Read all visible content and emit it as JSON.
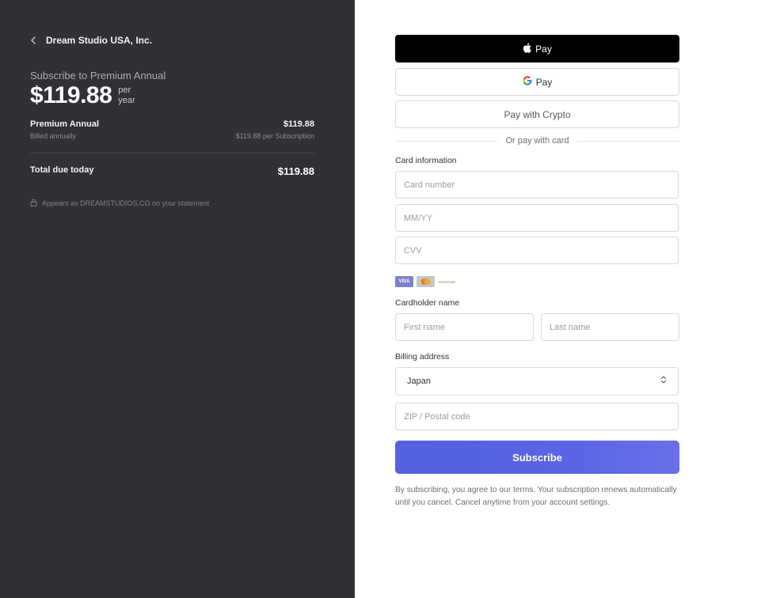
{
  "summary": {
    "merchant_name": "Dream Studio USA, Inc.",
    "subscribe_title": "Subscribe to Premium Annual",
    "price": "$119.88",
    "per_line1": "per",
    "per_line2": "year",
    "line_item": {
      "name": "Premium Annual",
      "amount": "$119.88",
      "billing": "Billed annually",
      "per_subscription": "$119.88 per Subscription"
    },
    "total_label": "Total due today",
    "total_amount": "$119.88",
    "statement": "Appears as DREAMSTUDIOS.CO on your statement"
  },
  "payment": {
    "apple_pay_label": "Pay",
    "google_pay_label": "Pay",
    "crypto_label": "Pay with Crypto",
    "divider_text": "Or pay with card",
    "card_info_label": "Card information",
    "card_number_placeholder": "Card number",
    "expiry_placeholder": "MM/YY",
    "cvv_placeholder": "CVV",
    "card_brands": [
      "VISA",
      "mastercard",
      "DISCOVER"
    ],
    "cardholder_label": "Cardholder name",
    "first_name_placeholder": "First name",
    "last_name_placeholder": "Last name",
    "billing_label": "Billing address",
    "country": "Japan",
    "zip_placeholder": "ZIP / Postal code",
    "subscribe_label": "Subscribe",
    "terms": "By subscribing, you agree to our terms. Your subscription renews automatically until you cancel. Cancel anytime from your account settings."
  },
  "colors": {
    "left_bg": "#303136",
    "accent": "#5461e0"
  }
}
